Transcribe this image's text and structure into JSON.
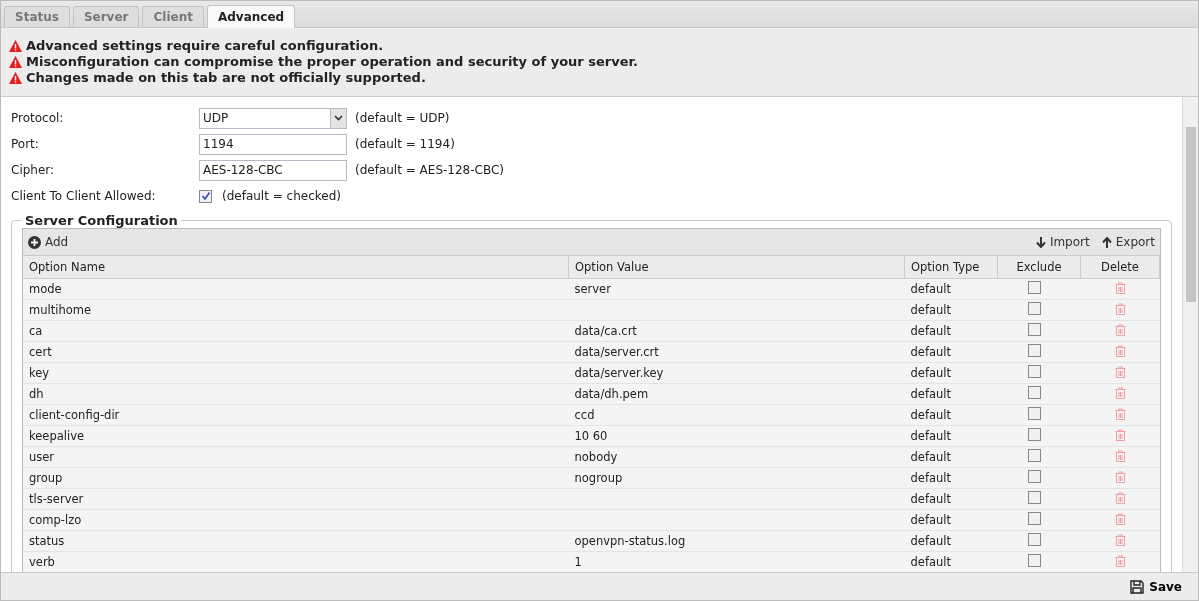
{
  "tabs": [
    {
      "label": "Status",
      "selected": false
    },
    {
      "label": "Server",
      "selected": false
    },
    {
      "label": "Client",
      "selected": false
    },
    {
      "label": "Advanced",
      "selected": true
    }
  ],
  "warnings": [
    "Advanced settings require careful configuration.",
    "Misconfiguration can compromise the proper operation and security of your server.",
    "Changes made on this tab are not officially supported."
  ],
  "form": [
    {
      "kind": "select",
      "label": "Protocol:",
      "value": "UDP",
      "hint": "(default = UDP)"
    },
    {
      "kind": "text",
      "label": "Port:",
      "value": "1194",
      "hint": "(default = 1194)"
    },
    {
      "kind": "text",
      "label": "Cipher:",
      "value": "AES-128-CBC",
      "hint": "(default = AES-128-CBC)"
    },
    {
      "kind": "checkbox",
      "label": "Client To Client Allowed:",
      "checked": true,
      "hint": "(default = checked)"
    }
  ],
  "server_configuration": {
    "title": "Server Configuration",
    "toolbar": {
      "add": "Add",
      "import": "Import",
      "export": "Export"
    },
    "columns": [
      "Option Name",
      "Option Value",
      "Option Type",
      "Exclude",
      "Delete"
    ],
    "rows": [
      {
        "name": "mode",
        "value": "server",
        "type": "default",
        "excluded": false
      },
      {
        "name": "multihome",
        "value": "",
        "type": "default",
        "excluded": false
      },
      {
        "name": "ca",
        "value": "data/ca.crt",
        "type": "default",
        "excluded": false
      },
      {
        "name": "cert",
        "value": "data/server.crt",
        "type": "default",
        "excluded": false
      },
      {
        "name": "key",
        "value": "data/server.key",
        "type": "default",
        "excluded": false
      },
      {
        "name": "dh",
        "value": "data/dh.pem",
        "type": "default",
        "excluded": false
      },
      {
        "name": "client-config-dir",
        "value": "ccd",
        "type": "default",
        "excluded": false
      },
      {
        "name": "keepalive",
        "value": "10 60",
        "type": "default",
        "excluded": false
      },
      {
        "name": "user",
        "value": "nobody",
        "type": "default",
        "excluded": false
      },
      {
        "name": "group",
        "value": "nogroup",
        "type": "default",
        "excluded": false
      },
      {
        "name": "tls-server",
        "value": "",
        "type": "default",
        "excluded": false
      },
      {
        "name": "comp-lzo",
        "value": "",
        "type": "default",
        "excluded": false
      },
      {
        "name": "status",
        "value": "openvpn-status.log",
        "type": "default",
        "excluded": false
      },
      {
        "name": "verb",
        "value": "1",
        "type": "default",
        "excluded": false
      }
    ]
  },
  "footer": {
    "save": "Save"
  }
}
